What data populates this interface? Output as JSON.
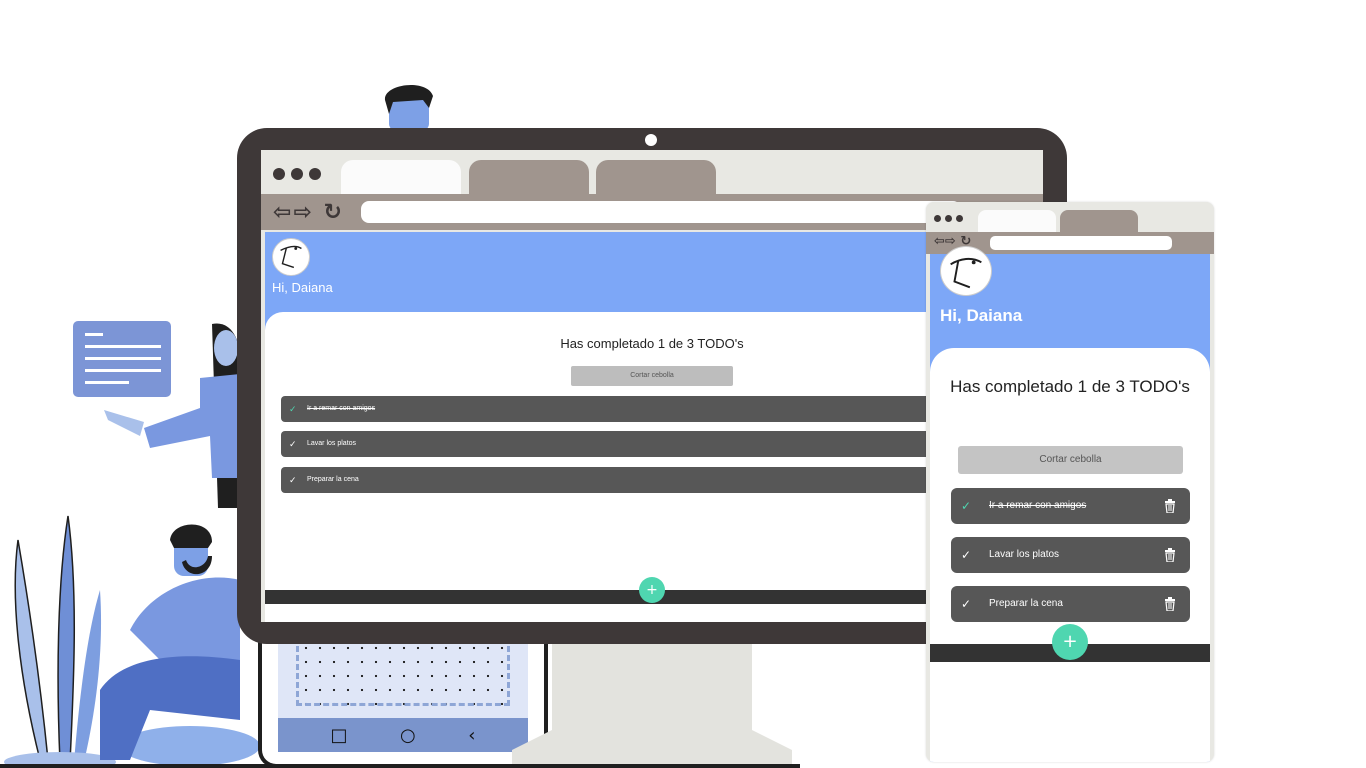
{
  "colors": {
    "header_blue": "#7da7f7",
    "item_gray": "#575757",
    "accent_teal": "#4fd6b0",
    "frame_dark": "#3e3838",
    "tab_gray": "#a0958e"
  },
  "desktop": {
    "greeting": "Hi, Daiana",
    "title": "Has completado 1 de 3 TODO's",
    "input_placeholder": "Cortar cebolla",
    "items": [
      {
        "text": "Ir a remar con amigos",
        "done": true
      },
      {
        "text": "Lavar los platos",
        "done": false
      },
      {
        "text": "Preparar la cena",
        "done": false
      }
    ],
    "fab_label": "+"
  },
  "mobile": {
    "greeting": "Hi, Daiana",
    "title": "Has completado 1 de 3 TODO's",
    "input_placeholder": "Cortar cebolla",
    "items": [
      {
        "text": "Ir a remar con amigos",
        "done": true
      },
      {
        "text": "Lavar los platos",
        "done": false
      },
      {
        "text": "Preparar la cena",
        "done": false
      }
    ],
    "fab_label": "+"
  },
  "icons": {
    "check": "✓",
    "nav_arrows": "⇦⇨",
    "reload": "↻",
    "phone_nav": [
      "□",
      "○",
      "‹"
    ]
  }
}
